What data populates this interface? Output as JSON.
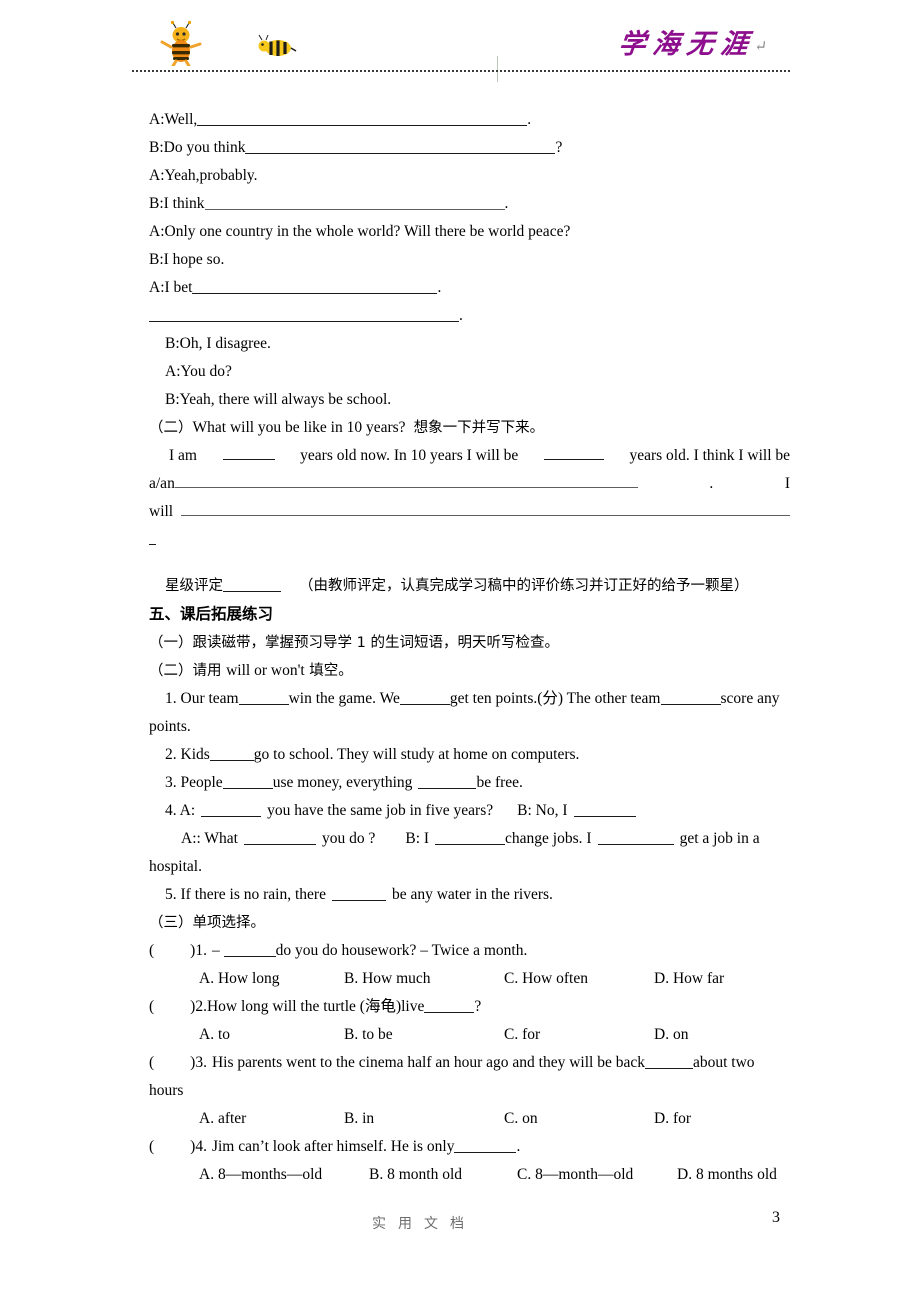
{
  "header": {
    "brand_text": "学海无涯",
    "brand_pilcrow": "↵",
    "brand_color": "#8e0f8e",
    "bee_left_icon": "bee-standing-icon",
    "bee_right_icon": "bee-flying-icon"
  },
  "dialogue": [
    {
      "speaker_text": "A:Well,",
      "blanks": [
        230,
        100
      ],
      "tail": "."
    },
    {
      "speaker_text": "B:Do you think",
      "blanks": [
        175,
        135
      ],
      "tail": "?"
    },
    {
      "speaker_text": "A:Yeah,probably.",
      "blanks": [],
      "tail": ""
    },
    {
      "speaker_text": "B:I think",
      "blanks": [
        180,
        120
      ],
      "tail": "."
    },
    {
      "speaker_text": "A:Only one country in the whole world? Will there be world peace?",
      "blanks": [],
      "tail": ""
    },
    {
      "speaker_text": "B:I hope so.",
      "blanks": [],
      "tail": ""
    },
    {
      "speaker_text": "A:I bet",
      "blanks": [
        160,
        85
      ],
      "tail": "."
    },
    {
      "speaker_text": "",
      "blanks": [
        225,
        85
      ],
      "tail": "."
    },
    {
      "speaker_text": "B:Oh, I disagree.",
      "blanks": [],
      "tail": ""
    },
    {
      "speaker_text": "A:You do?",
      "blanks": [],
      "tail": ""
    },
    {
      "speaker_text": "B:Yeah, there will always be school.",
      "blanks": [],
      "tail": ""
    }
  ],
  "section_two": {
    "label": "（二）",
    "english": "What will you be like in 10 years?",
    "chinese": "想象一下并写下来。"
  },
  "writing_task": {
    "part1a": "I am",
    "part1b": "years old now. In 10 years I will be",
    "part1c": "years old. I think I will be",
    "part2a": "a/an",
    "part2_period": ".",
    "part2b": "I",
    "part3a": "will",
    "part4": "."
  },
  "star_rating": {
    "label": "星级评定",
    "note": "（由教师评定，认真完成学习稿中的评价练习并订正好的给予一颗星）"
  },
  "section_five": {
    "heading": "五、课后拓展练习",
    "item_one": "（一）跟读磁带，掌握预习导学 1 的生词短语，明天听写检查。",
    "item_two_prefix": "（二）请用 ",
    "item_two_en": "will or won't",
    "item_two_suffix": " 填空。"
  },
  "fill_questions": [
    {
      "line1_a": "1. Our team",
      "line1_b": "win the game. We",
      "line1_c": "get ten points.(分) The other team",
      "line1_d": "score any",
      "line2": "points."
    },
    {
      "line1_a": "2. Kids",
      "line1_b": "go to school. They will study at home on computers."
    },
    {
      "line1_a": "3. People",
      "line1_b": "use money, everything",
      "line1_c": "be free."
    },
    {
      "line1_a": "4. A:",
      "line1_b": "you have the same job in five years?",
      "line1_c": "B: No, I",
      "line2_a": "A:: What",
      "line2_b": "you do ?",
      "line2_c": "B: I",
      "line2_d": "change jobs. I",
      "line2_e": "get a job in a",
      "line3": "hospital."
    },
    {
      "line1_a": "5. If there is no rain, there",
      "line1_b": "be any water in the rivers."
    }
  ],
  "section_three": {
    "heading": "（三）单项选择。"
  },
  "choice_questions": [
    {
      "paren_open": "(",
      "paren_close": ")",
      "number": "1.",
      "stem_a": "– ",
      "stem_b": "do you do housework? – Twice a month.",
      "options": [
        "A. How long",
        "B. How much",
        "C. How often",
        "D. How far"
      ]
    },
    {
      "paren_open": "(",
      "paren_close": ")",
      "number": "2.",
      "stem_a": "How long will the turtle (海龟)live",
      "stem_b": "?",
      "options": [
        "A. to",
        "B. to be",
        "C. for",
        "D. on"
      ]
    },
    {
      "paren_open": "(",
      "paren_close": ")",
      "number": "3.",
      "stem_a": "His parents went to the cinema half an hour ago and they will be back",
      "stem_b": "about two",
      "stem_wrap": "hours",
      "options": [
        "A.   after",
        "B.   in",
        "C.   on",
        "D.   for"
      ]
    },
    {
      "paren_open": "(",
      "paren_close": ")",
      "number": "4.",
      "stem_a": "Jim can’t look after himself. He is only",
      "stem_b": ".",
      "options": [
        "A.   8—months—old",
        "B.   8 month old",
        "C.   8—month—old",
        "D.   8 months old"
      ]
    }
  ],
  "footer": {
    "watermark": "实用文档",
    "page_number": "3"
  }
}
